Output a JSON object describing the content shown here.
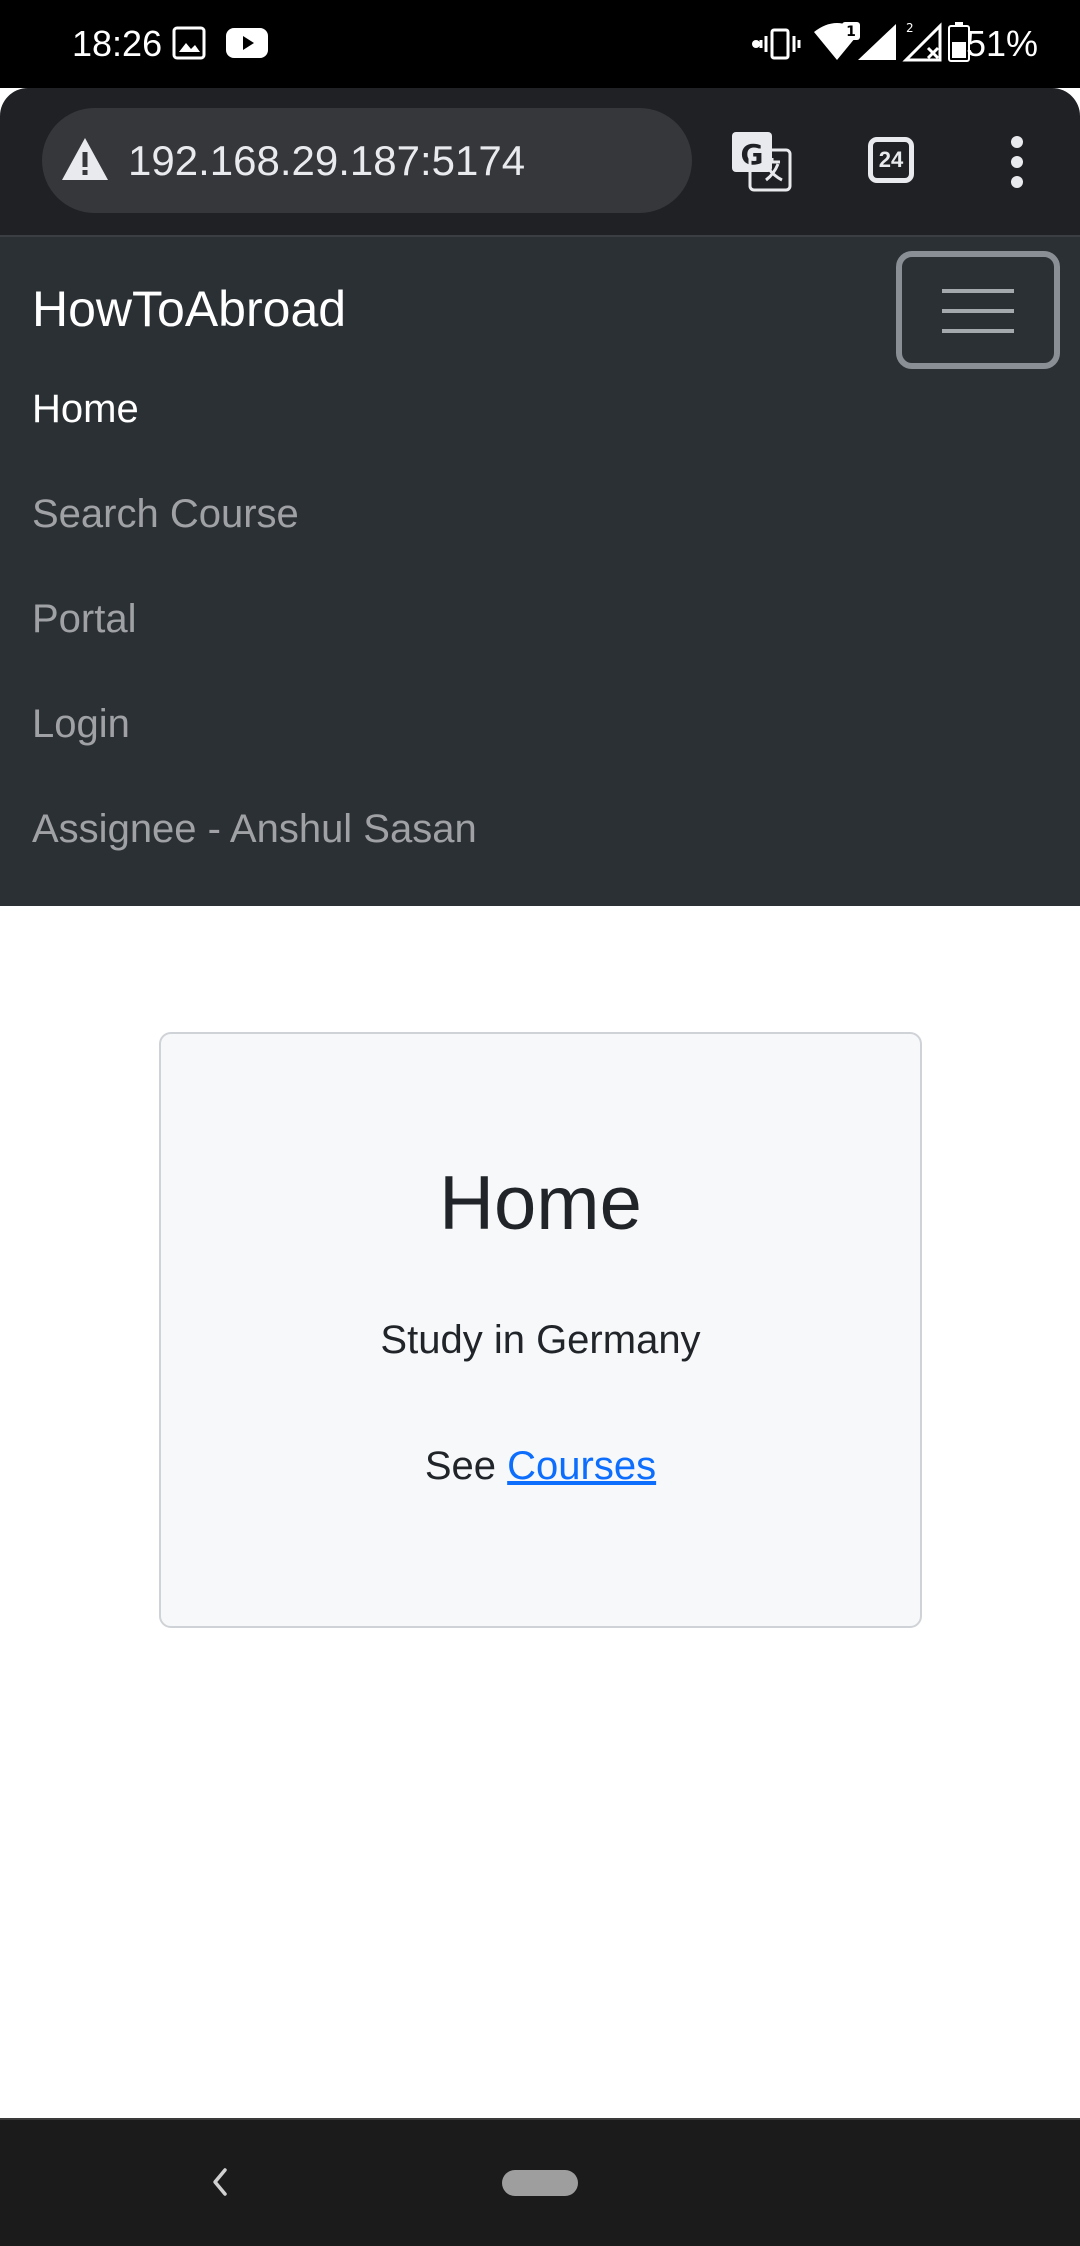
{
  "status_bar": {
    "time": "18:26",
    "battery": "51%",
    "icons": [
      "image-icon",
      "youtube-icon",
      "vibrate-icon",
      "wifi-icon",
      "signal-icon",
      "signal-no-data-icon",
      "battery-icon"
    ]
  },
  "browser": {
    "url": "192.168.29.187:5174",
    "tab_count": "24",
    "icons": [
      "warning-icon",
      "translate-icon",
      "tabs-icon",
      "more-vert-icon"
    ]
  },
  "navbar": {
    "brand": "HowToAbroad",
    "items": [
      {
        "label": "Home",
        "active": true
      },
      {
        "label": "Search Course",
        "active": false
      },
      {
        "label": "Portal",
        "active": false
      },
      {
        "label": "Login",
        "active": false
      },
      {
        "label": "Assignee - Anshul Sasan",
        "active": false
      }
    ]
  },
  "card": {
    "title": "Home",
    "subtitle": "Study in Germany",
    "see_prefix": "See",
    "link_label": "Courses"
  },
  "colors": {
    "navbar_bg": "#2b3035",
    "link": "#0d6efd",
    "card_bg": "#f7f8fa"
  }
}
